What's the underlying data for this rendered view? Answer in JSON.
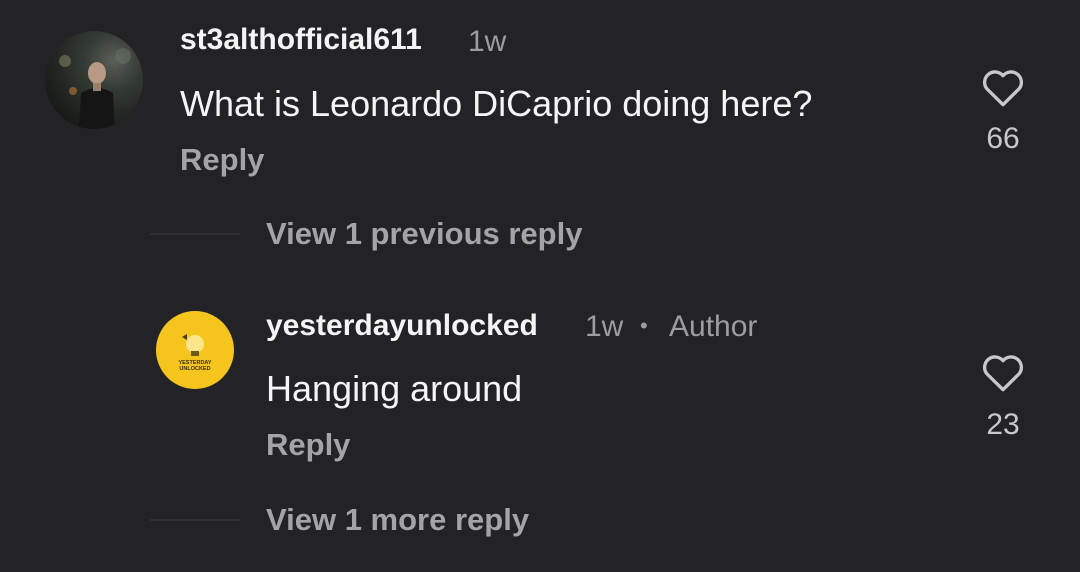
{
  "comments": [
    {
      "username": "st3althofficial611",
      "time": "1w",
      "text": "What is Leonardo DiCaprio doing here?",
      "reply_label": "Reply",
      "likes": "66"
    }
  ],
  "thread": {
    "view_previous_label": "View 1 previous reply",
    "reply": {
      "username": "yesterdayunlocked",
      "time": "1w",
      "separator": "•",
      "author_badge": "Author",
      "text": "Hanging around",
      "reply_label": "Reply",
      "likes": "23",
      "avatar_logo_text": [
        "YESTERDAY",
        "UNLOCKED"
      ]
    },
    "view_more_label": "View 1 more reply"
  },
  "icons": {
    "like": "heart-outline-icon"
  },
  "colors": {
    "background": "#232226",
    "avatar_yellow": "#f5c51d",
    "muted_text": "#a3a3a8"
  }
}
